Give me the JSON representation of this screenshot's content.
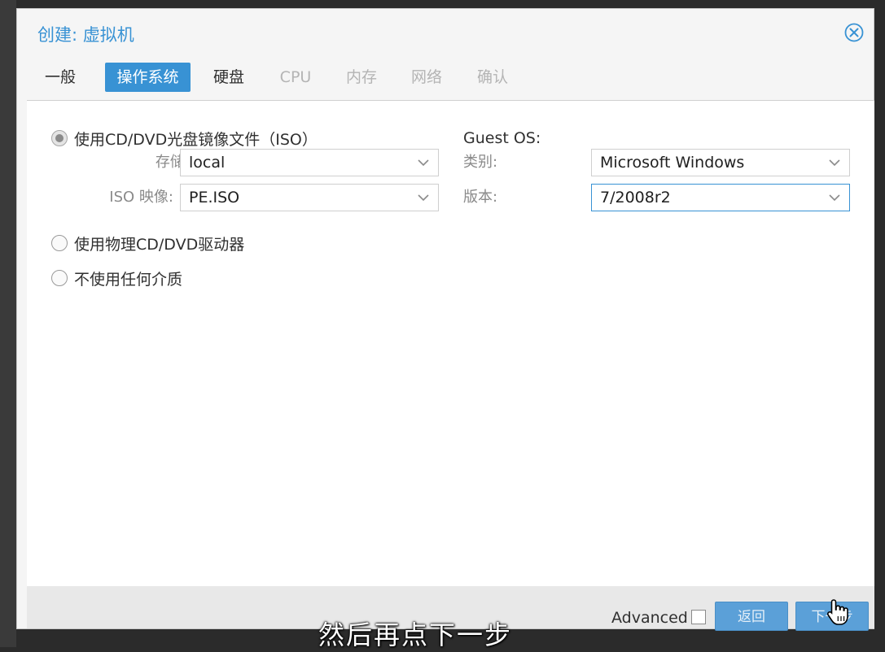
{
  "dialog": {
    "title": "创建: 虚拟机"
  },
  "tabs": [
    {
      "label": "一般",
      "state": "enabled"
    },
    {
      "label": "操作系统",
      "state": "active"
    },
    {
      "label": "硬盘",
      "state": "enabled"
    },
    {
      "label": "CPU",
      "state": "disabled"
    },
    {
      "label": "内存",
      "state": "disabled"
    },
    {
      "label": "网络",
      "state": "disabled"
    },
    {
      "label": "确认",
      "state": "disabled"
    }
  ],
  "media": {
    "option_iso": "使用CD/DVD光盘镜像文件（ISO）",
    "option_physical": "使用物理CD/DVD驱动器",
    "option_none": "不使用任何介质",
    "selected": "iso",
    "storage_label": "存储:",
    "storage_value": "local",
    "iso_label": "ISO 映像:",
    "iso_value": "PE.ISO"
  },
  "guest_os": {
    "title": "Guest OS:",
    "type_label": "类别:",
    "type_value": "Microsoft Windows",
    "version_label": "版本:",
    "version_value": "7/2008r2"
  },
  "footer": {
    "advanced_label": "Advanced",
    "advanced_checked": false,
    "back_label": "返回",
    "next_label": "下一步"
  },
  "subtitle": "然后再点下一步",
  "colors": {
    "accent": "#3892d4",
    "button": "#5ba0d8",
    "disabled_text": "#b4b4b4"
  }
}
